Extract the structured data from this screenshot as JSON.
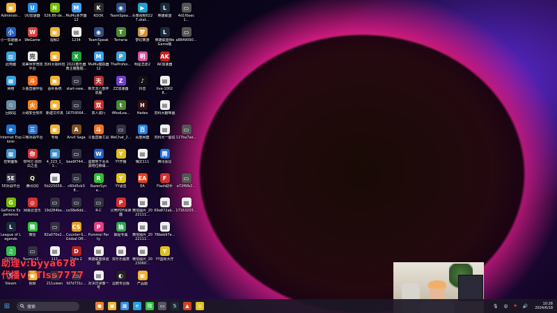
{
  "desktop": {
    "icons": [
      {
        "label": "Administr...",
        "col": 0,
        "row": 0,
        "color": "#f2b233",
        "glyph": "▣"
      },
      {
        "label": "UU加速器",
        "col": 1,
        "row": 0,
        "color": "#2d8ce0",
        "glyph": "U"
      },
      {
        "label": "526.86-de...",
        "col": 2,
        "row": 0,
        "color": "#76b900",
        "glyph": "N"
      },
      {
        "label": "MuMu多开器12",
        "col": 3,
        "row": 0,
        "color": "#3fa0f0",
        "glyph": "M"
      },
      {
        "label": "KOOK",
        "col": 4,
        "row": 0,
        "color": "#2a2a2a",
        "glyph": "K"
      },
      {
        "label": "TeamSpea...",
        "col": 5,
        "row": 0,
        "color": "#2c4e80",
        "glyph": "◉"
      },
      {
        "label": "头像视频0227.skat...",
        "col": 6,
        "row": 0,
        "color": "#20a0d0",
        "glyph": "▶"
      },
      {
        "label": "英雄联盟",
        "col": 7,
        "row": 0,
        "color": "#1a2a3a",
        "glyph": "L"
      },
      {
        "label": "4d1f0eec1...",
        "col": 8,
        "row": 0,
        "color": "#555555",
        "glyph": "▭"
      },
      {
        "label": "小一加速器.exe",
        "col": 0,
        "row": 1,
        "color": "#2060c0",
        "glyph": "小"
      },
      {
        "label": "WeGame",
        "col": 1,
        "row": 1,
        "color": "#e04040",
        "glyph": "W"
      },
      {
        "label": "视频2",
        "col": 2,
        "row": 1,
        "color": "#f2b233",
        "glyph": "▣"
      },
      {
        "label": "1234",
        "col": 3,
        "row": 1,
        "color": "#f0f0f0",
        "glyph": "▤"
      },
      {
        "label": "TeamSpeak 3",
        "col": 4,
        "row": 1,
        "color": "#2c4e80",
        "glyph": "◉"
      },
      {
        "label": "Terraria",
        "col": 5,
        "row": 1,
        "color": "#4a8a30",
        "glyph": "T"
      },
      {
        "label": "梦幻西游",
        "col": 6,
        "row": 1,
        "color": "#d09030",
        "glyph": "梦"
      },
      {
        "label": "英雄联盟WeGame版",
        "col": 7,
        "row": 1,
        "color": "#1a2a3a",
        "glyph": "L"
      },
      {
        "label": "a8849090...",
        "col": 8,
        "row": 1,
        "color": "#555555",
        "glyph": "▭"
      },
      {
        "label": "此电脑",
        "col": 0,
        "row": 2,
        "color": "#3aa0e0",
        "glyph": "▥"
      },
      {
        "label": "完美世界竞技平台",
        "col": 1,
        "row": 2,
        "color": "#e8e8e8",
        "glyph": "完"
      },
      {
        "label": "苏科大视科包",
        "col": 2,
        "row": 2,
        "color": "#f2b233",
        "glyph": "▣"
      },
      {
        "label": "2022春乐器典主播整题...",
        "col": 3,
        "row": 2,
        "color": "#20a040",
        "glyph": "X"
      },
      {
        "label": "MuMu模拟器12",
        "col": 4,
        "row": 2,
        "color": "#3fa0f0",
        "glyph": "M"
      },
      {
        "label": "TheProfes...",
        "col": 5,
        "row": 2,
        "color": "#40a0d0",
        "glyph": "P"
      },
      {
        "label": "明星志愿2",
        "col": 6,
        "row": 2,
        "color": "#d050a0",
        "glyph": "明"
      },
      {
        "label": "AK加速器",
        "col": 7,
        "row": 2,
        "color": "#c02020",
        "glyph": "AK"
      },
      {
        "label": "网络",
        "col": 0,
        "row": 3,
        "color": "#3aa0e0",
        "glyph": "▦"
      },
      {
        "label": "斗鱼直播伴侣",
        "col": 1,
        "row": 3,
        "color": "#f07020",
        "glyph": "斗"
      },
      {
        "label": "恶补系统",
        "col": 2,
        "row": 3,
        "color": "#f2b233",
        "glyph": "▣"
      },
      {
        "label": "start-new...",
        "col": 3,
        "row": 3,
        "color": "#303040",
        "glyph": "▭"
      },
      {
        "label": "新天龙八部怀旧服",
        "col": 4,
        "row": 3,
        "color": "#b03030",
        "glyph": "天"
      },
      {
        "label": "ZZ加速器",
        "col": 5,
        "row": 3,
        "color": "#7040d0",
        "glyph": "Z"
      },
      {
        "label": "抖音",
        "col": 6,
        "row": 3,
        "color": "#111111",
        "glyph": "♪"
      },
      {
        "label": "live-10028...",
        "col": 7,
        "row": 3,
        "color": "#f0f0f0",
        "glyph": "▤"
      },
      {
        "label": "回收站",
        "col": 0,
        "row": 4,
        "color": "#6a8aa0",
        "glyph": "♲"
      },
      {
        "label": "火绒安全软件",
        "col": 1,
        "row": 4,
        "color": "#f08020",
        "glyph": "火"
      },
      {
        "label": "新建文件夹",
        "col": 2,
        "row": 4,
        "color": "#f2b233",
        "glyph": "▣"
      },
      {
        "label": "16759564...",
        "col": 3,
        "row": 4,
        "color": "#303040",
        "glyph": "▭"
      },
      {
        "label": "双人成行",
        "col": 4,
        "row": 4,
        "color": "#c03030",
        "glyph": "双"
      },
      {
        "label": "tModLoa...",
        "col": 5,
        "row": 4,
        "color": "#4a8a30",
        "glyph": "t"
      },
      {
        "label": "Hades",
        "col": 6,
        "row": 4,
        "color": "#301010",
        "glyph": "H"
      },
      {
        "label": "苏科大趣味画",
        "col": 7,
        "row": 4,
        "color": "#f0f0f0",
        "glyph": "▤"
      },
      {
        "label": "Internet Explorer",
        "col": 0,
        "row": 5,
        "color": "#1a70d0",
        "glyph": "e"
      },
      {
        "label": "三哪对战平台",
        "col": 1,
        "row": 5,
        "color": "#3070c0",
        "glyph": "三"
      },
      {
        "label": "专组",
        "col": 2,
        "row": 5,
        "color": "#f2b233",
        "glyph": "▣"
      },
      {
        "label": "Anvil Saga",
        "col": 3,
        "row": 5,
        "color": "#805020",
        "glyph": "A"
      },
      {
        "label": "斗鱼直播工具",
        "col": 4,
        "row": 5,
        "color": "#f07020",
        "glyph": "斗"
      },
      {
        "label": "WeChat_2...",
        "col": 5,
        "row": 5,
        "color": "#303040",
        "glyph": "▭"
      },
      {
        "label": "百度网盘",
        "col": 6,
        "row": 5,
        "color": "#2080e0",
        "glyph": "百"
      },
      {
        "label": "苏科大一图说",
        "col": 7,
        "row": 5,
        "color": "#f0f0f0",
        "glyph": "▤"
      },
      {
        "label": "117ba7ae...",
        "col": 8,
        "row": 5,
        "color": "#555555",
        "glyph": "▭"
      },
      {
        "label": "控制面板",
        "col": 0,
        "row": 6,
        "color": "#3a90d0",
        "glyph": "▩"
      },
      {
        "label": "你叫它·造你白之名",
        "col": 1,
        "row": 6,
        "color": "#d03030",
        "glyph": "你"
      },
      {
        "label": "4_223_1_1...",
        "col": 2,
        "row": 6,
        "color": "#3a90d0",
        "glyph": "▦"
      },
      {
        "label": "bee9f744...",
        "col": 3,
        "row": 6,
        "color": "#303040",
        "glyph": "▭"
      },
      {
        "label": "黑暗地下水水源地位移缘...",
        "col": 4,
        "row": 6,
        "color": "#2060c0",
        "glyph": "W"
      },
      {
        "label": "YY开播",
        "col": 5,
        "row": 6,
        "color": "#e0c020",
        "glyph": "Y"
      },
      {
        "label": "嗨文111",
        "col": 6,
        "row": 6,
        "color": "#f0f0f0",
        "glyph": "▤"
      },
      {
        "label": "腾讯会议",
        "col": 7,
        "row": 6,
        "color": "#2070e0",
        "glyph": "腾"
      },
      {
        "label": "5E对战平台",
        "col": 0,
        "row": 7,
        "color": "#303040",
        "glyph": "5E"
      },
      {
        "label": "腾讯QQ",
        "col": 1,
        "row": 7,
        "color": "#111111",
        "glyph": "Q"
      },
      {
        "label": "5b225059...",
        "col": 2,
        "row": 7,
        "color": "#f0f0f0",
        "glyph": "▤"
      },
      {
        "label": "c60d5cb38...",
        "col": 3,
        "row": 7,
        "color": "#303040",
        "glyph": "▭"
      },
      {
        "label": "RazerSyna...",
        "col": 4,
        "row": 7,
        "color": "#30c030",
        "glyph": "R"
      },
      {
        "label": "YY语音",
        "col": 5,
        "row": 7,
        "color": "#e0c020",
        "glyph": "Y"
      },
      {
        "label": "EA",
        "col": 6,
        "row": 7,
        "color": "#e04020",
        "glyph": "EA"
      },
      {
        "label": "Flash助手",
        "col": 7,
        "row": 7,
        "color": "#d03030",
        "glyph": "F"
      },
      {
        "label": "e72f6fb2...",
        "col": 8,
        "row": 7,
        "color": "#555555",
        "glyph": "▭"
      },
      {
        "label": "GeForce Experience",
        "col": 0,
        "row": 8,
        "color": "#76b900",
        "glyph": "G"
      },
      {
        "label": "网易云音乐",
        "col": 1,
        "row": 8,
        "color": "#d03030",
        "glyph": "◎"
      },
      {
        "label": "19d284be...",
        "col": 2,
        "row": 8,
        "color": "#303040",
        "glyph": "▭"
      },
      {
        "label": "ce38e6dd...",
        "col": 3,
        "row": 8,
        "color": "#303040",
        "glyph": "▭"
      },
      {
        "label": "R-C",
        "col": 4,
        "row": 8,
        "color": "#303040",
        "glyph": "▭"
      },
      {
        "label": "贝壳PDF阅读器",
        "col": 5,
        "row": 8,
        "color": "#d03030",
        "glyph": "P"
      },
      {
        "label": "微信图片_2022111...",
        "col": 6,
        "row": 8,
        "color": "#f0f0f0",
        "glyph": "▤"
      },
      {
        "label": "69a872ab...",
        "col": 7,
        "row": 8,
        "color": "#f0f0f0",
        "glyph": "▤"
      },
      {
        "label": "17163203...",
        "col": 8,
        "row": 8,
        "color": "#f0f0f0",
        "glyph": "▤"
      },
      {
        "label": "League of Legends",
        "col": 0,
        "row": 9,
        "color": "#1a2a3a",
        "glyph": "L"
      },
      {
        "label": "微信",
        "col": 1,
        "row": 9,
        "color": "#30c040",
        "glyph": "微"
      },
      {
        "label": "82a070e2...",
        "col": 2,
        "row": 9,
        "color": "#303040",
        "glyph": "▭"
      },
      {
        "label": "Counter-S...Global Off...",
        "col": 3,
        "row": 9,
        "color": "#e0a020",
        "glyph": "CS"
      },
      {
        "label": "Pummel Party",
        "col": 4,
        "row": 9,
        "color": "#e04080",
        "glyph": "P"
      },
      {
        "label": "抽屉专属",
        "col": 5,
        "row": 9,
        "color": "#30a050",
        "glyph": "抽"
      },
      {
        "label": "微信图片_2022111...",
        "col": 6,
        "row": 9,
        "color": "#f0f0f0",
        "glyph": "▤"
      },
      {
        "label": "78beb97e...",
        "col": 7,
        "row": 9,
        "color": "#f0f0f0",
        "glyph": "▤"
      },
      {
        "label": "QQ音乐",
        "col": 0,
        "row": 10,
        "color": "#30c050",
        "glyph": "♫"
      },
      {
        "label": "Yuumi-s2...",
        "col": 1,
        "row": 10,
        "color": "#303040",
        "glyph": "▭"
      },
      {
        "label": "111",
        "col": 2,
        "row": 10,
        "color": "#f0f0f0",
        "glyph": "▤"
      },
      {
        "label": "Dota 2",
        "col": 3,
        "row": 10,
        "color": "#b02020",
        "glyph": "D"
      },
      {
        "label": "英雄联盟体验服",
        "col": 4,
        "row": 10,
        "color": "#f0f0f0",
        "glyph": "▤"
      },
      {
        "label": "双乐乐画意",
        "col": 5,
        "row": 10,
        "color": "#f0f0f0",
        "glyph": "▤"
      },
      {
        "label": "微信图片_2023060...",
        "col": 6,
        "row": 10,
        "color": "#f0f0f0",
        "glyph": "▤"
      },
      {
        "label": "YY国际大厅",
        "col": 7,
        "row": 10,
        "color": "#e0c020",
        "glyph": "Y"
      },
      {
        "label": "Steam",
        "col": 0,
        "row": 11,
        "color": "#1b2838",
        "glyph": "S"
      },
      {
        "label": "视频",
        "col": 1,
        "row": 11,
        "color": "#f2b233",
        "glyph": "▣"
      },
      {
        "label": "211uieen",
        "col": 2,
        "row": 11,
        "color": "#303040",
        "glyph": "▭"
      },
      {
        "label": "fd7d731c...",
        "col": 3,
        "row": 11,
        "color": "#303040",
        "glyph": "▭"
      },
      {
        "label": "对决日录像一号",
        "col": 4,
        "row": 11,
        "color": "#f0f0f0",
        "glyph": "▤"
      },
      {
        "label": "逗鹅专业版",
        "col": 5,
        "row": 11,
        "color": "#222222",
        "glyph": "◐"
      },
      {
        "label": "产品图",
        "col": 6,
        "row": 11,
        "color": "#f2b233",
        "glyph": "▣"
      }
    ]
  },
  "overlay": {
    "line1": "助理v:byya678",
    "line2": "代播v：Tlss7777"
  },
  "taskbar": {
    "start_glyph": "⊞",
    "search_placeholder": "搜索",
    "pinned": [
      {
        "name": "taskbar-app-1",
        "color": "#f08030",
        "glyph": "●"
      },
      {
        "name": "taskbar-explorer",
        "color": "#f2b233",
        "glyph": "▣"
      },
      {
        "name": "taskbar-app-3",
        "color": "#3a90e0",
        "glyph": "▦"
      },
      {
        "name": "taskbar-edge",
        "color": "#2aa0e0",
        "glyph": "e"
      },
      {
        "name": "taskbar-wechat",
        "color": "#30c040",
        "glyph": "微"
      },
      {
        "name": "taskbar-app-6",
        "color": "#555566",
        "glyph": "▭"
      },
      {
        "name": "taskbar-steam",
        "color": "#1b2838",
        "glyph": "S"
      },
      {
        "name": "taskbar-app-8",
        "color": "#d04020",
        "glyph": "▲"
      },
      {
        "name": "taskbar-app-9",
        "color": "#e0c020",
        "glyph": "◎"
      }
    ],
    "tray": {
      "mic": "🎙",
      "ime": "中",
      "extra": "⚑",
      "volume": "🔊"
    },
    "clock": {
      "time": "10:28",
      "date": "2024/6/18"
    }
  },
  "colors": {
    "overlay_text": "#ff3a50",
    "taskbar_bg": "#1c1826"
  }
}
